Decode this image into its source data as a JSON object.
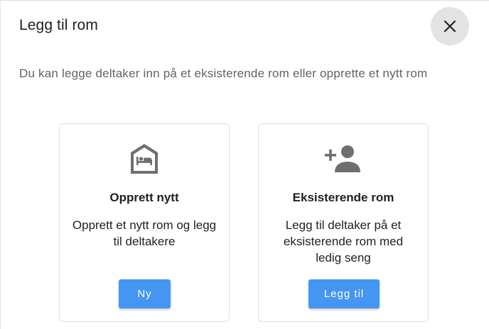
{
  "dialog": {
    "title": "Legg til rom",
    "subtitle": "Du kan legge deltaker inn på et eksisterende rom eller opprette et nytt rom",
    "close_icon": "close-icon"
  },
  "options": [
    {
      "icon": "room-bed-icon",
      "title": "Opprett nytt",
      "description": "Opprett et nytt rom og legg til deltakere",
      "button_label": "Ny"
    },
    {
      "icon": "add-person-icon",
      "title": "Eksisterende rom",
      "description": "Legg til deltaker på et eksisterende rom med ledig seng",
      "button_label": "Legg til"
    }
  ],
  "colors": {
    "accent": "#4496f2",
    "icon_gray": "#6f6f6f",
    "close_bg": "#e3e3e3"
  }
}
